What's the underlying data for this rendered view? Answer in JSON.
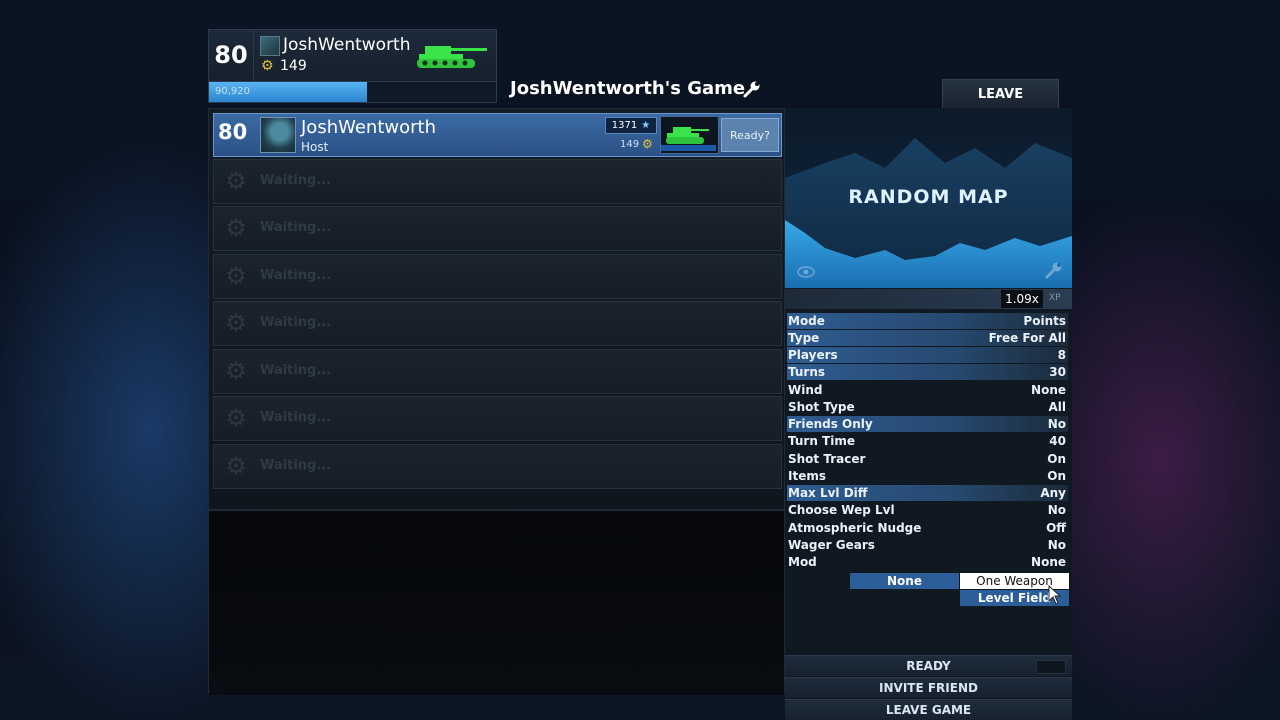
{
  "profile": {
    "level": "80",
    "name": "JoshWentworth",
    "gears": "149",
    "xp_value": "90,920",
    "xp_progress": 0.55
  },
  "lobby": {
    "title": "JoshWentworth's Game",
    "leave_label": "LEAVE"
  },
  "players": {
    "host": {
      "level": "80",
      "name": "JoshWentworth",
      "role": "Host",
      "rank": "1371",
      "gears": "149",
      "ready_label": "Ready?"
    },
    "waiting_slots": [
      {
        "label": "Waiting..."
      },
      {
        "label": "Waiting..."
      },
      {
        "label": "Waiting..."
      },
      {
        "label": "Waiting..."
      },
      {
        "label": "Waiting..."
      },
      {
        "label": "Waiting..."
      },
      {
        "label": "Waiting..."
      }
    ]
  },
  "map": {
    "title": "RANDOM MAP",
    "xp_multiplier": "1.09x",
    "xp_label": "XP"
  },
  "settings": [
    {
      "key": "Mode",
      "value": "Points"
    },
    {
      "key": "Type",
      "value": "Free For All"
    },
    {
      "key": "Players",
      "value": "8"
    },
    {
      "key": "Turns",
      "value": "30"
    },
    {
      "key": "Wind",
      "value": "None"
    },
    {
      "key": "Shot Type",
      "value": "All"
    },
    {
      "key": "Friends Only",
      "value": "No"
    },
    {
      "key": "Turn Time",
      "value": "40"
    },
    {
      "key": "Shot Tracer",
      "value": "On"
    },
    {
      "key": "Items",
      "value": "On"
    },
    {
      "key": "Max Lvl Diff",
      "value": "Any"
    },
    {
      "key": "Choose Wep Lvl",
      "value": "No"
    },
    {
      "key": "Atmospheric Nudge",
      "value": "Off"
    },
    {
      "key": "Wager Gears",
      "value": "No"
    },
    {
      "key": "Mod",
      "value": "None"
    }
  ],
  "mod_dropdown": {
    "options": [
      "None",
      "One Weapon",
      "Level Field"
    ],
    "hovered": "One Weapon"
  },
  "actions": {
    "ready": "READY",
    "invite": "INVITE FRIEND",
    "leave_game": "LEAVE GAME"
  },
  "colors": {
    "accent_blue": "#2c5e9a",
    "tank_green": "#3be34a",
    "gear_gold": "#e6c23a"
  },
  "icons": [
    "gear-icon",
    "wrench-icon",
    "star-icon",
    "eye-icon",
    "tank-icon",
    "cursor-icon"
  ]
}
